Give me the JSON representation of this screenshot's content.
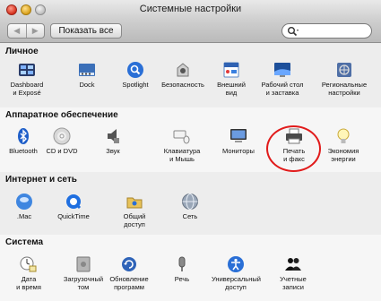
{
  "window": {
    "title": "Системные настройки"
  },
  "toolbar": {
    "back_label": "◀",
    "forward_label": "▶",
    "show_all_label": "Показать все",
    "search_value": "",
    "search_placeholder": ""
  },
  "sections": [
    {
      "title": "Личное",
      "items": [
        {
          "label": "Dashboard\nи Exposé",
          "icon": "dashboard-expose-icon"
        },
        {
          "label": "Dock",
          "icon": "dock-icon"
        },
        {
          "label": "Spotlight",
          "icon": "spotlight-icon"
        },
        {
          "label": "Безопасность",
          "icon": "security-icon"
        },
        {
          "label": "Внешний\nвид",
          "icon": "appearance-icon"
        },
        {
          "label": "Рабочий стол\nи заставка",
          "icon": "desktop-screensaver-icon"
        },
        {
          "label": "Региональные\nнастройки",
          "icon": "international-icon"
        }
      ]
    },
    {
      "title": "Аппаратное обеспечение",
      "items": [
        {
          "label": "Bluetooth",
          "icon": "bluetooth-icon"
        },
        {
          "label": "CD и DVD",
          "icon": "cd-dvd-icon"
        },
        {
          "label": "Звук",
          "icon": "sound-icon"
        },
        {
          "label": "Клавиатура\nи Мышь",
          "icon": "keyboard-mouse-icon"
        },
        {
          "label": "Мониторы",
          "icon": "displays-icon"
        },
        {
          "label": "Печать\nи факс",
          "icon": "print-fax-icon"
        },
        {
          "label": "Экономия\nэнергии",
          "icon": "energy-saver-icon"
        }
      ]
    },
    {
      "title": "Интернет и сеть",
      "items": [
        {
          "label": ".Mac",
          "icon": "dotmac-icon"
        },
        {
          "label": "QuickTime",
          "icon": "quicktime-icon"
        },
        {
          "label": "Общий\nдоступ",
          "icon": "sharing-icon"
        },
        {
          "label": "Сеть",
          "icon": "network-icon"
        }
      ]
    },
    {
      "title": "Система",
      "items": [
        {
          "label": "Дата\nи время",
          "icon": "date-time-icon"
        },
        {
          "label": "Загрузочный\nтом",
          "icon": "startup-disk-icon"
        },
        {
          "label": "Обновление\nпрограмм",
          "icon": "software-update-icon"
        },
        {
          "label": "Речь",
          "icon": "speech-icon"
        },
        {
          "label": "Универсальный\nдоступ",
          "icon": "universal-access-icon"
        },
        {
          "label": "Учетные\nзаписи",
          "icon": "accounts-icon"
        }
      ]
    }
  ],
  "colors": {
    "highlight": "#e11b1b",
    "accent_blue": "#2a6fd6"
  }
}
